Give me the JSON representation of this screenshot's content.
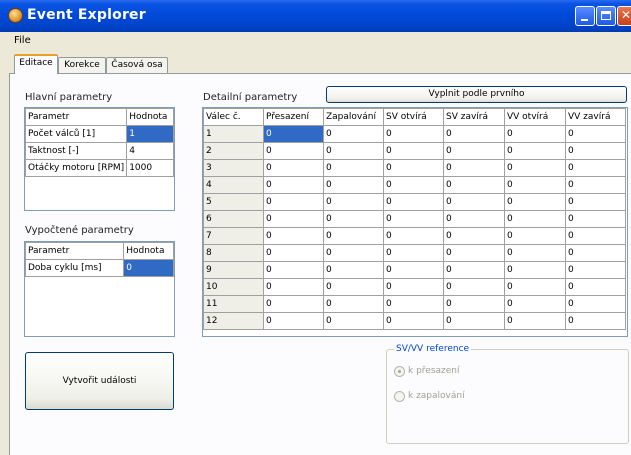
{
  "window": {
    "title": "Event Explorer"
  },
  "menu": {
    "file": "File"
  },
  "tabs": [
    "Editace",
    "Korekce",
    "Časová osa"
  ],
  "main_params": {
    "title": "Hlavní parametry",
    "headers": [
      "Parametr",
      "Hodnota"
    ],
    "rows": [
      [
        "Počet válců [1]",
        "1"
      ],
      [
        "Taktnost [-]",
        "4"
      ],
      [
        "Otáčky motoru [RPM]",
        "1000"
      ]
    ]
  },
  "computed_params": {
    "title": "Vypočtené parametry",
    "headers": [
      "Parametr",
      "Hodnota"
    ],
    "rows": [
      [
        "Doba cyklu [ms]",
        "0"
      ]
    ]
  },
  "detail_params": {
    "title": "Detailní parametry",
    "fill_button": "Vyplnit podle prvního",
    "headers": [
      "Válec č.",
      "Přesazení",
      "Zapalování",
      "SV otvírá",
      "SV zavírá",
      "VV otvírá",
      "VV zavírá"
    ],
    "rows": [
      [
        "1",
        "0",
        "0",
        "0",
        "0",
        "0",
        "0"
      ],
      [
        "2",
        "0",
        "0",
        "0",
        "0",
        "0",
        "0"
      ],
      [
        "3",
        "0",
        "0",
        "0",
        "0",
        "0",
        "0"
      ],
      [
        "4",
        "0",
        "0",
        "0",
        "0",
        "0",
        "0"
      ],
      [
        "5",
        "0",
        "0",
        "0",
        "0",
        "0",
        "0"
      ],
      [
        "6",
        "0",
        "0",
        "0",
        "0",
        "0",
        "0"
      ],
      [
        "7",
        "0",
        "0",
        "0",
        "0",
        "0",
        "0"
      ],
      [
        "8",
        "0",
        "0",
        "0",
        "0",
        "0",
        "0"
      ],
      [
        "9",
        "0",
        "0",
        "0",
        "0",
        "0",
        "0"
      ],
      [
        "10",
        "0",
        "0",
        "0",
        "0",
        "0",
        "0"
      ],
      [
        "11",
        "0",
        "0",
        "0",
        "0",
        "0",
        "0"
      ],
      [
        "12",
        "0",
        "0",
        "0",
        "0",
        "0",
        "0"
      ]
    ]
  },
  "create_button": "Vytvořit události",
  "reference": {
    "title": "SV/VV reference",
    "options": [
      "k přesazení",
      "k zapalování"
    ],
    "selected": "k přesazení"
  },
  "colors": {
    "titlebar": "#0049d8",
    "selection": "#316ac5",
    "tab_accent": "#e7a12b"
  }
}
